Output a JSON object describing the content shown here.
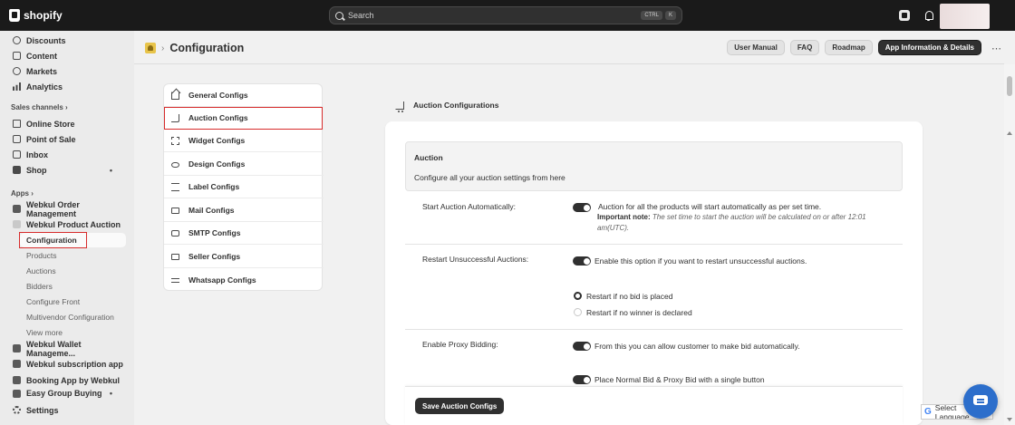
{
  "topbar": {
    "brand": "shopify",
    "search_placeholder": "Search",
    "shortcut_keys": [
      "CTRL",
      "K"
    ]
  },
  "sidebar": {
    "items_top": [
      {
        "label": "Discounts",
        "icon": "discount-icon"
      },
      {
        "label": "Content",
        "icon": "content-icon"
      },
      {
        "label": "Markets",
        "icon": "globe-icon"
      },
      {
        "label": "Analytics",
        "icon": "analytics-icon"
      }
    ],
    "sales_channels_label": "Sales channels",
    "sales_channels": [
      {
        "label": "Online Store",
        "icon": "online-store-icon"
      },
      {
        "label": "Point of Sale",
        "icon": "pos-icon"
      },
      {
        "label": "Inbox",
        "icon": "inbox-icon"
      },
      {
        "label": "Shop",
        "icon": "shop-icon"
      }
    ],
    "apps_label": "Apps",
    "apps": [
      {
        "label": "Webkul Order Management",
        "icon": "app-icon"
      },
      {
        "label": "Webkul Product Auction",
        "icon": "app-icon"
      }
    ],
    "auction_sub_items": [
      "Configuration",
      "Products",
      "Auctions",
      "Bidders",
      "Configure Front",
      "Multivendor Configuration",
      "View more"
    ],
    "apps_more": [
      {
        "label": "Webkul Wallet Manageme...",
        "icon": "app-icon"
      },
      {
        "label": "Webkul subscription app",
        "icon": "app-icon"
      },
      {
        "label": "Booking App by Webkul",
        "icon": "app-icon"
      },
      {
        "label": "Easy Group Buying",
        "icon": "app-icon"
      }
    ],
    "settings_label": "Settings"
  },
  "header": {
    "title": "Configuration",
    "buttons": [
      "User Manual",
      "FAQ",
      "Roadmap",
      "App Information & Details"
    ]
  },
  "config_menu": [
    {
      "label": "General Configs",
      "icon": "home-icon"
    },
    {
      "label": "Auction Configs",
      "icon": "cart-icon"
    },
    {
      "label": "Widget Configs",
      "icon": "frame-icon"
    },
    {
      "label": "Design Configs",
      "icon": "eye-icon"
    },
    {
      "label": "Label Configs",
      "icon": "label-icon"
    },
    {
      "label": "Mail Configs",
      "icon": "mail-icon"
    },
    {
      "label": "SMTP Configs",
      "icon": "smtp-icon"
    },
    {
      "label": "Seller Configs",
      "icon": "seller-icon"
    },
    {
      "label": "Whatsapp Configs",
      "icon": "whatsapp-icon"
    }
  ],
  "auction_panel": {
    "section_title": "Auction Configurations",
    "box_title": "Auction",
    "box_desc": "Configure all your auction settings from here",
    "start_auto": {
      "label": "Start Auction Automatically:",
      "text": "Auction for all the products will start automatically as per set time.",
      "note_bold": "Important note:",
      "note": "The set time to start the auction will be calculated on or after 12:01 am(UTC)."
    },
    "restart": {
      "label": "Restart Unsuccessful Auctions:",
      "text": "Enable this option if you want to restart unsuccessful auctions.",
      "radio_options": [
        "Restart if no bid is placed",
        "Restart if no winner is declared"
      ],
      "radio_selected": "Restart if no bid is placed"
    },
    "proxy": {
      "label": "Enable Proxy Bidding:",
      "text": "From this you can allow customer to make bid automatically.",
      "text2": "Place Normal Bid & Proxy Bid with a single button"
    },
    "save_label": "Save Auction Configs"
  },
  "translate_label": "Select Language",
  "colors": {
    "topbar": "#1a1a1a",
    "highlight": "#d72c2c",
    "chat": "#2c6ecb"
  }
}
